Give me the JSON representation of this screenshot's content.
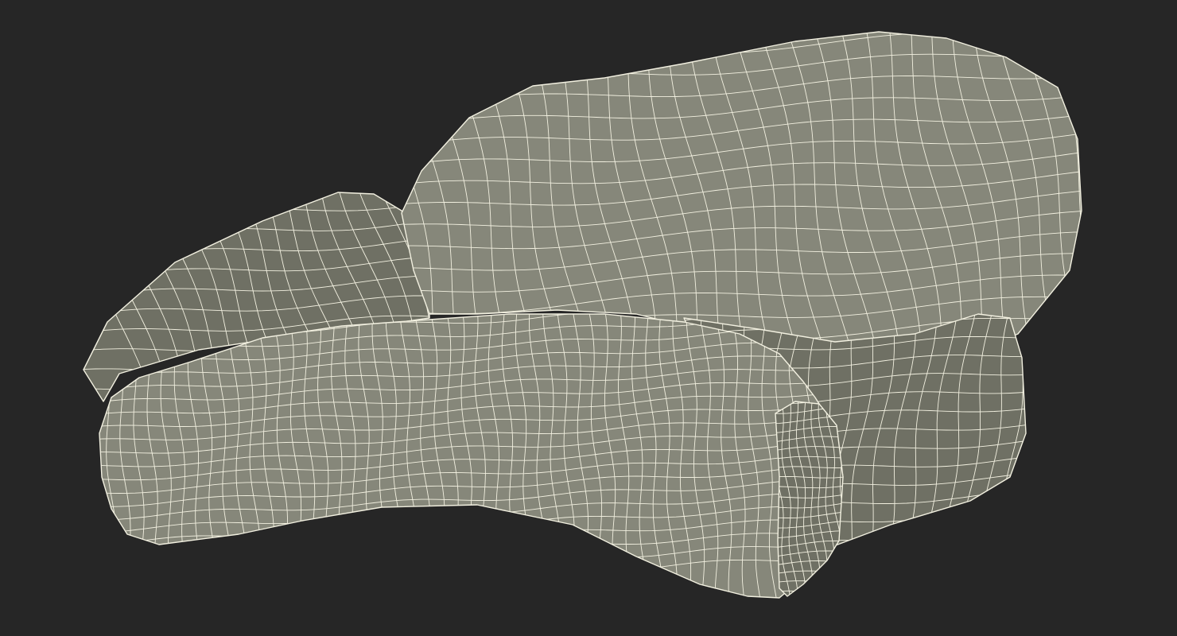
{
  "viewport": {
    "background": "#262626"
  },
  "model": {
    "subject": "wireframe-sofa-render",
    "surface_color": "#86877a",
    "shade_color": "#6f7064",
    "highlight_color": "#9a9b8e",
    "wire_color": "#f2f0e0"
  }
}
